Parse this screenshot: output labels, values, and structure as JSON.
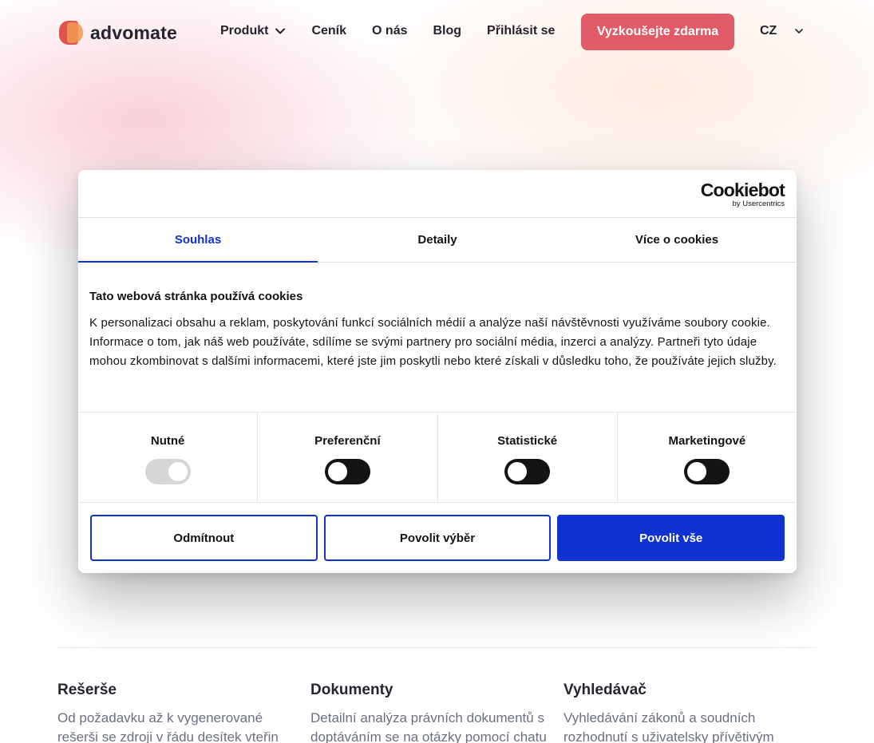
{
  "header": {
    "logo_text": "advomate",
    "nav": [
      {
        "label": "Produkt"
      },
      {
        "label": "Ceník"
      },
      {
        "label": "O nás"
      },
      {
        "label": "Blog"
      },
      {
        "label": "Přihlásit se"
      }
    ],
    "cta_label": "Vyzkoušejte zdarma",
    "language": "CZ",
    "colors": {
      "cta": "#e05a67"
    }
  },
  "cookie_dialog": {
    "brand": "Cookiebot",
    "brand_sub": "by Usercentrics",
    "tabs": [
      {
        "label": "Souhlas",
        "active": true
      },
      {
        "label": "Detaily",
        "active": false
      },
      {
        "label": "Více o cookies",
        "active": false
      }
    ],
    "title": "Tato webová stránka používá cookies",
    "text": "K personalizaci obsahu a reklam, poskytování funkcí sociálních médií a analýze naší návštěvnosti využíváme soubory cookie. Informace o tom, jak náš web používáte, sdílíme se svými partnery pro sociální média, inzerci a analýzy. Partneři tyto údaje mohou zkombinovat s dalšími informacemi, které jste jim poskytli nebo které získali v důsledku toho, že používáte jejich služby.",
    "toggles": [
      {
        "label": "Nutné",
        "checked": true,
        "disabled": true
      },
      {
        "label": "Preferenční",
        "checked": false,
        "disabled": false
      },
      {
        "label": "Statistické",
        "checked": false,
        "disabled": false
      },
      {
        "label": "Marketingové",
        "checked": false,
        "disabled": false
      }
    ],
    "buttons": {
      "reject": "Odmítnout",
      "allow_selection": "Povolit výběr",
      "allow_all": "Povolit vše"
    },
    "colors": {
      "accent": "#1032cf"
    }
  },
  "features": [
    {
      "title": "Rešerše",
      "text": "Od požadavku až k vygenerované rešerši se zdroji v řádu desítek vteřin"
    },
    {
      "title": "Dokumenty",
      "text": "Detailní analýza právních dokumentů s doptáváním se na otázky pomocí chatu"
    },
    {
      "title": "Vyhledávač",
      "text": "Vyhledávání zákonů a soudních rozhodnutí s uživatelsky přívětivým"
    }
  ]
}
